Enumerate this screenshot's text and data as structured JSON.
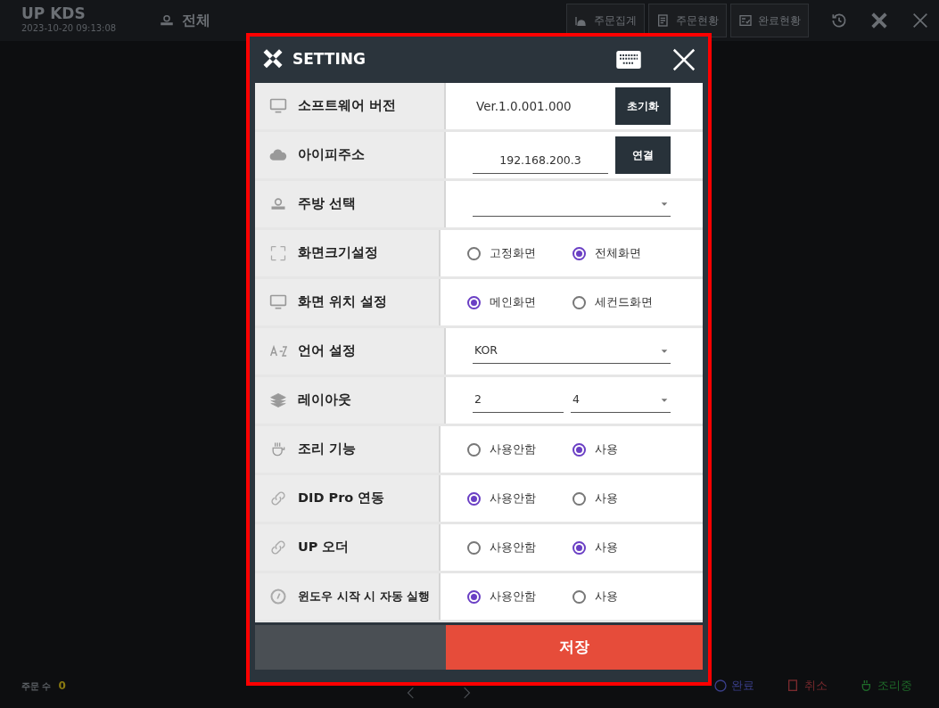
{
  "top_bar": {
    "title": "UP KDS",
    "datetime": "2023-10-20 09:13:08",
    "kitchen": "전체",
    "buttons": [
      "주문집계",
      "주문현황",
      "완료현황"
    ]
  },
  "dialog": {
    "title": "SETTING",
    "rows": [
      {
        "kind": "version",
        "label": "소프트웨어 버전",
        "value": "Ver.1.0.001.000",
        "button": "초기화"
      },
      {
        "kind": "input",
        "label": "아이피주소",
        "value": "192.168.200.3",
        "button": "연결"
      },
      {
        "kind": "select",
        "label": "주방 선택"
      },
      {
        "kind": "radio",
        "label": "화면크기설정",
        "options": [
          {
            "label": "고정화면",
            "selected": false
          },
          {
            "label": "전체화면",
            "selected": true
          }
        ]
      },
      {
        "kind": "radio",
        "label": "화면 위치 설정",
        "options": [
          {
            "label": "메인화면",
            "selected": true
          },
          {
            "label": "세컨드화면",
            "selected": false
          }
        ]
      },
      {
        "kind": "select",
        "label": "언어 설정",
        "value": "KOR"
      },
      {
        "kind": "pair",
        "label": "레이아웃",
        "values": [
          "2",
          "4"
        ]
      },
      {
        "kind": "radio",
        "label": "조리 기능",
        "options": [
          {
            "label": "사용안함",
            "selected": false
          },
          {
            "label": "사용",
            "selected": true
          }
        ]
      },
      {
        "kind": "radio",
        "label": "DID Pro 연동",
        "options": [
          {
            "label": "사용안함",
            "selected": true
          },
          {
            "label": "사용",
            "selected": false
          }
        ]
      },
      {
        "kind": "radio",
        "label": "UP 오더",
        "options": [
          {
            "label": "사용안함",
            "selected": false
          },
          {
            "label": "사용",
            "selected": true
          }
        ]
      },
      {
        "kind": "radio",
        "label": "윈도우 시작 시 자동 실행",
        "options": [
          {
            "label": "사용안함",
            "selected": true
          },
          {
            "label": "사용",
            "selected": false
          }
        ]
      }
    ],
    "save": "저장"
  },
  "bottom_bar": {
    "order_count_label": "주문 수",
    "order_count": "0",
    "actions": [
      {
        "label": "완료",
        "color": "#3a3f8a"
      },
      {
        "label": "취소",
        "color": "#7a2a2e"
      },
      {
        "label": "조리중",
        "color": "#1f6b2a"
      }
    ]
  }
}
